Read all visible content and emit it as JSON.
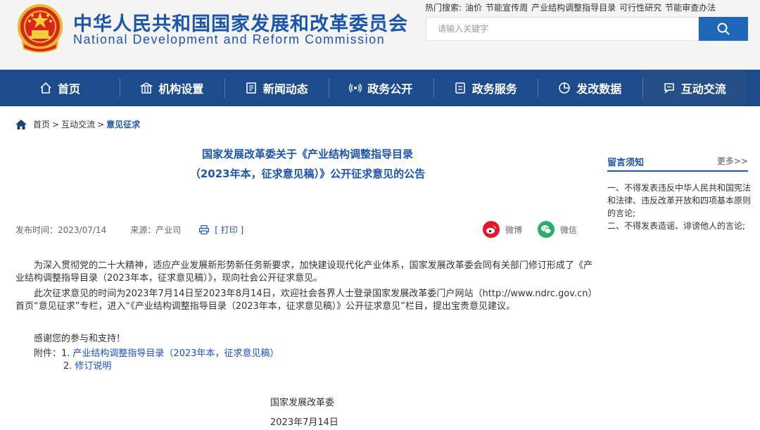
{
  "header": {
    "title_cn": "中华人民共和国国家发展和改革委员会",
    "title_en": "National Development and Reform Commission",
    "hot_search_label": "热门搜索:",
    "hot_terms": [
      "油价",
      "节能宣传周",
      "产业结构调整指导目录",
      "可行性研究",
      "节能审查办法"
    ],
    "search_placeholder": "请输入关键字"
  },
  "nav": [
    {
      "label": "首页",
      "icon": "home-icon"
    },
    {
      "label": "机构设置",
      "icon": "institution-icon"
    },
    {
      "label": "新闻动态",
      "icon": "news-icon"
    },
    {
      "label": "政务公开",
      "icon": "broadcast-icon"
    },
    {
      "label": "政务服务",
      "icon": "service-icon"
    },
    {
      "label": "发改数据",
      "icon": "pie-chart-icon"
    },
    {
      "label": "互动交流",
      "icon": "chat-icon"
    }
  ],
  "breadcrumb": {
    "home": "首页",
    "sep1": ">",
    "section": "互动交流",
    "sep2": ">",
    "current": "意见征求"
  },
  "article": {
    "title_line1": "国家发展改革委关于《产业结构调整指导目录",
    "title_line2": "（2023年本，征求意见稿）》公开征求意见的公告",
    "publish_label": "发布时间：",
    "publish_date": "2023/07/14",
    "source_label": "来源：",
    "source": "产业司",
    "print": "[ 打印 ]",
    "share_weibo": "微博",
    "share_wechat": "微信",
    "p1": "为深入贯彻党的二十大精神，适应产业发展新形势新任务新要求，加快建设现代化产业体系，国家发展改革委会同有关部门修订形成了《产业结构调整指导目录（2023年本，征求意见稿）》，现向社会公开征求意见。",
    "p2": "此次征求意见的时间为2023年7月14日至2023年8月14日，欢迎社会各界人士登录国家发展改革委门户网站（http://www.ndrc.gov.cn）首页“意见征求”专栏，进入“《产业结构调整指导目录（2023年本，征求意见稿）》公开征求意见”栏目，提出宝贵意见建议。",
    "p3": "感谢您的参与和支持！",
    "attach_label": "附件：",
    "attach1_num": "1.",
    "attach1": "产业结构调整指导目录（2023年本，征求意见稿）",
    "attach2_num": "2.",
    "attach2": "修订说明",
    "signer": "国家发展改革委",
    "sign_date": "2023年7月14日"
  },
  "sidebar": {
    "title": "留言须知",
    "more": "更多>>",
    "rule1": "一、不得发表违反中华人民共和国宪法和法律、违反改革开放和四项基本原则的言论;",
    "rule2": "二、不得发表造谣、诽谤他人的言论;"
  },
  "colors": {
    "brand_blue": "#1d55a8",
    "nav_bg": "#1c4c8c",
    "link": "#1a4fc6",
    "weibo": "#e6162d",
    "wechat": "#2aae67"
  }
}
